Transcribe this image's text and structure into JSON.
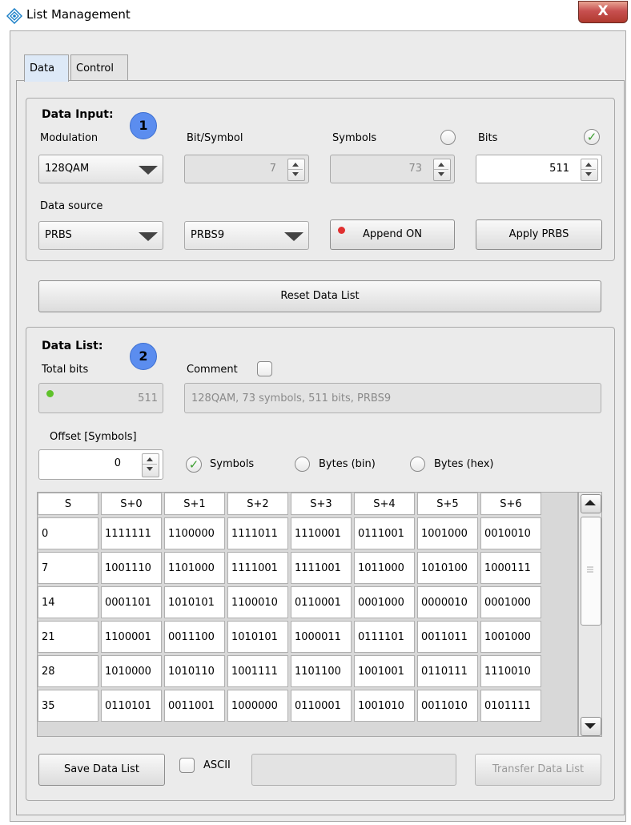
{
  "window": {
    "title": "List Management",
    "close_label": "X"
  },
  "tabs": [
    {
      "label": "Data"
    },
    {
      "label": "Control"
    }
  ],
  "data_input": {
    "heading": "Data Input:",
    "badge": "1",
    "modulation_label": "Modulation",
    "modulation_value": "128QAM",
    "bit_symbol_label": "Bit/Symbol",
    "bit_symbol_value": "7",
    "symbols_label": "Symbols",
    "symbols_value": "73",
    "bits_label": "Bits",
    "bits_value": "511",
    "data_source_label": "Data source",
    "data_source_value": "PRBS",
    "prbs_type_value": "PRBS9",
    "append_label": "Append ON",
    "apply_label": "Apply PRBS"
  },
  "reset_label": "Reset Data List",
  "data_list": {
    "heading": "Data List:",
    "badge": "2",
    "total_bits_label": "Total bits",
    "total_bits_value": "511",
    "comment_label": "Comment",
    "comment_value": "128QAM, 73 symbols, 511 bits, PRBS9",
    "offset_label": "Offset [Symbols]",
    "offset_value": "0",
    "view_symbols": "Symbols",
    "view_bytes_bin": "Bytes (bin)",
    "view_bytes_hex": "Bytes (hex)"
  },
  "table": {
    "headers": [
      "S",
      "S+0",
      "S+1",
      "S+2",
      "S+3",
      "S+4",
      "S+5",
      "S+6"
    ],
    "rows": [
      [
        "0",
        "1111111",
        "1100000",
        "1111011",
        "1110001",
        "0111001",
        "1001000",
        "0010010"
      ],
      [
        "7",
        "1001110",
        "1101000",
        "1111001",
        "1111001",
        "1011000",
        "1010100",
        "1000111"
      ],
      [
        "14",
        "0001101",
        "1010101",
        "1100010",
        "0110001",
        "0001000",
        "0000010",
        "0001000"
      ],
      [
        "21",
        "1100001",
        "0011100",
        "1010101",
        "1000011",
        "0111101",
        "0011011",
        "1001000"
      ],
      [
        "28",
        "1010000",
        "1010110",
        "1001111",
        "1101100",
        "1001001",
        "0110111",
        "1110010"
      ],
      [
        "35",
        "0110101",
        "0011001",
        "1000000",
        "0110001",
        "1001010",
        "0011010",
        "0101111"
      ]
    ]
  },
  "footer": {
    "save_label": "Save Data List",
    "ascii_label": "ASCII",
    "transfer_label": "Transfer Data List"
  },
  "colors": {
    "led_red": "#e03030",
    "led_green": "#5fc22b",
    "badge_blue": "#5b8def",
    "check_green": "#3a9e2e"
  }
}
